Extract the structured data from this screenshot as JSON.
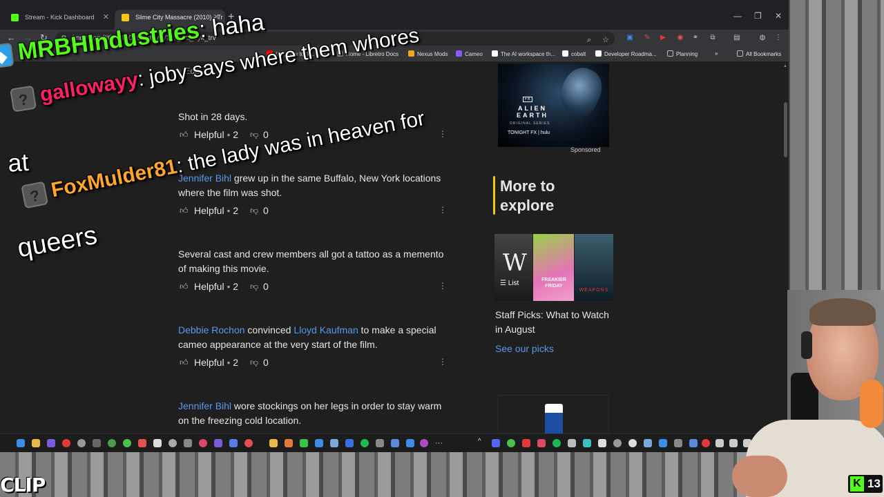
{
  "browser": {
    "tabs": [
      {
        "title": "Stream - Kick Dashboard",
        "icon": "kick-icon",
        "color": "#53fc18"
      },
      {
        "title": "Slime City Massacre (2010) - Tr",
        "icon": "imdb-icon",
        "color": "#f5c518"
      }
    ],
    "url": "imdb.com/title/tt1401631/trivia/?ref_=tt_dyk_trv",
    "bookmarks": [
      {
        "label": "(17) How to IRL Stre...",
        "color": "#ff0000"
      },
      {
        "label": "Home - Libretro Docs",
        "color": "#888888"
      },
      {
        "label": "Nexus Mods",
        "color": "#f5a623"
      },
      {
        "label": "Cameo",
        "color": "#8a5cf6"
      },
      {
        "label": "The AI workspace th...",
        "color": "#ffffff"
      },
      {
        "label": "cobalt",
        "color": "#ffffff"
      },
      {
        "label": "Developer Roadma...",
        "color": "#ffffff"
      },
      {
        "label": "Planning",
        "color": "#bbbbbb"
      },
      {
        "label": "All Bookmarks",
        "color": "#bbbbbb"
      }
    ]
  },
  "page": {
    "edit_label": "Edit",
    "trivia": [
      {
        "pre": "",
        "link1": "",
        "mid": "Shot in 28 days.",
        "link2": "",
        "post": "",
        "helpful": "Helpful",
        "up": "2",
        "down": "0"
      },
      {
        "pre": "",
        "link1": "Jennifer Bihl",
        "mid": " grew up in the same Buffalo, New York locations where the film was shot.",
        "link2": "",
        "post": "",
        "helpful": "Helpful",
        "up": "2",
        "down": "0"
      },
      {
        "pre": "",
        "link1": "",
        "mid": "Several cast and crew members all got a tattoo as a memento of making this movie.",
        "link2": "",
        "post": "",
        "helpful": "Helpful",
        "up": "2",
        "down": "0"
      },
      {
        "pre": "",
        "link1": "Debbie Rochon",
        "mid": " convinced ",
        "link2": "Lloyd Kaufman",
        "post": " to make a special cameo appearance at the very start of the film.",
        "helpful": "Helpful",
        "up": "2",
        "down": "0"
      },
      {
        "pre": "",
        "link1": "Jennifer Bihl",
        "mid": " wore stockings on her legs in order to stay warm on the freezing cold location.",
        "link2": "",
        "post": "",
        "helpful": "",
        "up": "",
        "down": ""
      }
    ],
    "ad": {
      "badge": "FX",
      "title": "ALIEN EARTH",
      "subtitle": "ORIGINAL SERIES",
      "tagline": "TONIGHT FX | hulu"
    },
    "sponsored": "Sponsored",
    "explore_title": "More to explore",
    "posters": [
      "W",
      "FREAKIER FRIDAY",
      "WEAPONS"
    ],
    "list_label": "List",
    "staff_picks": "Staff Picks: What to Watch in August",
    "see_picks": "See our picks"
  },
  "chat": [
    {
      "user": "MRBHIndustries",
      "message": ": haha",
      "user_color": "#53fc18"
    },
    {
      "user": "gallowayy",
      "message": ": joby says where them whores",
      "user_color": "#ff1e6e"
    },
    {
      "user": "",
      "message": "at",
      "user_color": ""
    },
    {
      "user": "FoxMulder81",
      "message": ": the lady was in heaven for",
      "user_color": "#ffa52a"
    },
    {
      "user": "",
      "message": "queers",
      "user_color": ""
    }
  ],
  "stream": {
    "clip_label": "CLIP",
    "viewer_count": "13",
    "kick_color": "#53fc18"
  }
}
